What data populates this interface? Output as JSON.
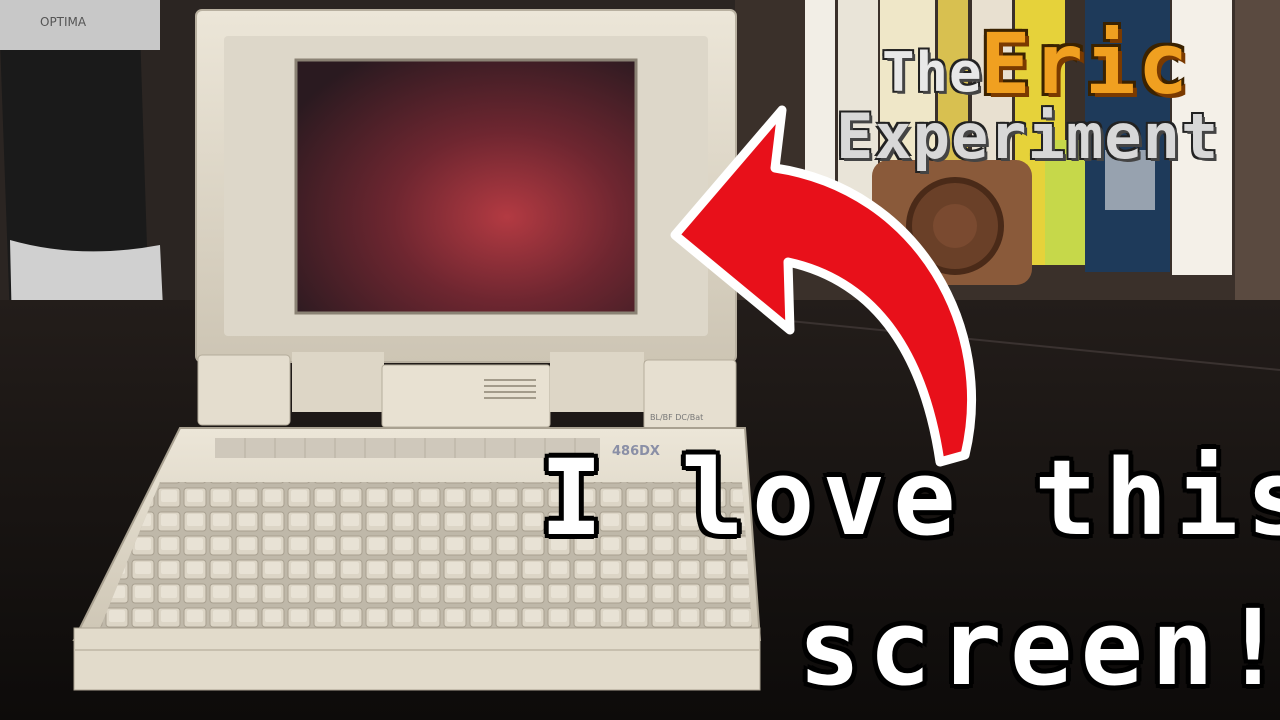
{
  "caption": {
    "line1": "I love this",
    "line2": "screen!"
  },
  "logo": {
    "the": "The",
    "eric": "Eric",
    "experiment": "Experiment"
  },
  "laptop_badge": {
    "model": "486DX",
    "indicators": "BL/BF DC/Bat"
  },
  "speaker_brand": "OPTIMA",
  "colors": {
    "arrow": "#e8101a",
    "arrow_outline": "#ffffff",
    "caption_text": "#ffffff",
    "caption_outline": "#000000",
    "logo_eric": "#f0a020",
    "logo_gray": "#d8d8d8",
    "laptop_body": "#e6e0d2",
    "screen_glow": "#a8333a"
  }
}
